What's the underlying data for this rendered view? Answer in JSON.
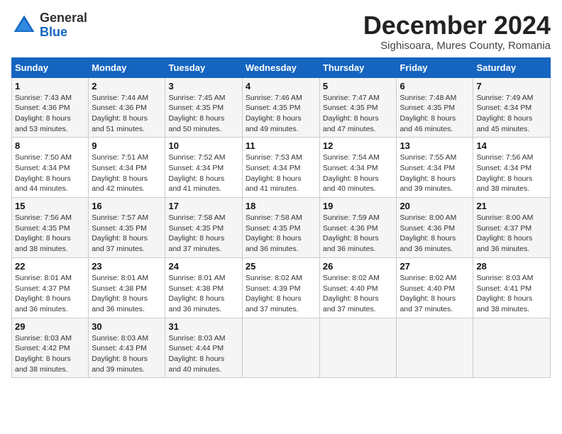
{
  "header": {
    "logo_line1": "General",
    "logo_line2": "Blue",
    "month_year": "December 2024",
    "location": "Sighisoara, Mures County, Romania"
  },
  "weekdays": [
    "Sunday",
    "Monday",
    "Tuesday",
    "Wednesday",
    "Thursday",
    "Friday",
    "Saturday"
  ],
  "weeks": [
    [
      {
        "day": "1",
        "info": "Sunrise: 7:43 AM\nSunset: 4:36 PM\nDaylight: 8 hours\nand 53 minutes."
      },
      {
        "day": "2",
        "info": "Sunrise: 7:44 AM\nSunset: 4:36 PM\nDaylight: 8 hours\nand 51 minutes."
      },
      {
        "day": "3",
        "info": "Sunrise: 7:45 AM\nSunset: 4:35 PM\nDaylight: 8 hours\nand 50 minutes."
      },
      {
        "day": "4",
        "info": "Sunrise: 7:46 AM\nSunset: 4:35 PM\nDaylight: 8 hours\nand 49 minutes."
      },
      {
        "day": "5",
        "info": "Sunrise: 7:47 AM\nSunset: 4:35 PM\nDaylight: 8 hours\nand 47 minutes."
      },
      {
        "day": "6",
        "info": "Sunrise: 7:48 AM\nSunset: 4:35 PM\nDaylight: 8 hours\nand 46 minutes."
      },
      {
        "day": "7",
        "info": "Sunrise: 7:49 AM\nSunset: 4:34 PM\nDaylight: 8 hours\nand 45 minutes."
      }
    ],
    [
      {
        "day": "8",
        "info": "Sunrise: 7:50 AM\nSunset: 4:34 PM\nDaylight: 8 hours\nand 44 minutes."
      },
      {
        "day": "9",
        "info": "Sunrise: 7:51 AM\nSunset: 4:34 PM\nDaylight: 8 hours\nand 42 minutes."
      },
      {
        "day": "10",
        "info": "Sunrise: 7:52 AM\nSunset: 4:34 PM\nDaylight: 8 hours\nand 41 minutes."
      },
      {
        "day": "11",
        "info": "Sunrise: 7:53 AM\nSunset: 4:34 PM\nDaylight: 8 hours\nand 41 minutes."
      },
      {
        "day": "12",
        "info": "Sunrise: 7:54 AM\nSunset: 4:34 PM\nDaylight: 8 hours\nand 40 minutes."
      },
      {
        "day": "13",
        "info": "Sunrise: 7:55 AM\nSunset: 4:34 PM\nDaylight: 8 hours\nand 39 minutes."
      },
      {
        "day": "14",
        "info": "Sunrise: 7:56 AM\nSunset: 4:34 PM\nDaylight: 8 hours\nand 38 minutes."
      }
    ],
    [
      {
        "day": "15",
        "info": "Sunrise: 7:56 AM\nSunset: 4:35 PM\nDaylight: 8 hours\nand 38 minutes."
      },
      {
        "day": "16",
        "info": "Sunrise: 7:57 AM\nSunset: 4:35 PM\nDaylight: 8 hours\nand 37 minutes."
      },
      {
        "day": "17",
        "info": "Sunrise: 7:58 AM\nSunset: 4:35 PM\nDaylight: 8 hours\nand 37 minutes."
      },
      {
        "day": "18",
        "info": "Sunrise: 7:58 AM\nSunset: 4:35 PM\nDaylight: 8 hours\nand 36 minutes."
      },
      {
        "day": "19",
        "info": "Sunrise: 7:59 AM\nSunset: 4:36 PM\nDaylight: 8 hours\nand 36 minutes."
      },
      {
        "day": "20",
        "info": "Sunrise: 8:00 AM\nSunset: 4:36 PM\nDaylight: 8 hours\nand 36 minutes."
      },
      {
        "day": "21",
        "info": "Sunrise: 8:00 AM\nSunset: 4:37 PM\nDaylight: 8 hours\nand 36 minutes."
      }
    ],
    [
      {
        "day": "22",
        "info": "Sunrise: 8:01 AM\nSunset: 4:37 PM\nDaylight: 8 hours\nand 36 minutes."
      },
      {
        "day": "23",
        "info": "Sunrise: 8:01 AM\nSunset: 4:38 PM\nDaylight: 8 hours\nand 36 minutes."
      },
      {
        "day": "24",
        "info": "Sunrise: 8:01 AM\nSunset: 4:38 PM\nDaylight: 8 hours\nand 36 minutes."
      },
      {
        "day": "25",
        "info": "Sunrise: 8:02 AM\nSunset: 4:39 PM\nDaylight: 8 hours\nand 37 minutes."
      },
      {
        "day": "26",
        "info": "Sunrise: 8:02 AM\nSunset: 4:40 PM\nDaylight: 8 hours\nand 37 minutes."
      },
      {
        "day": "27",
        "info": "Sunrise: 8:02 AM\nSunset: 4:40 PM\nDaylight: 8 hours\nand 37 minutes."
      },
      {
        "day": "28",
        "info": "Sunrise: 8:03 AM\nSunset: 4:41 PM\nDaylight: 8 hours\nand 38 minutes."
      }
    ],
    [
      {
        "day": "29",
        "info": "Sunrise: 8:03 AM\nSunset: 4:42 PM\nDaylight: 8 hours\nand 38 minutes."
      },
      {
        "day": "30",
        "info": "Sunrise: 8:03 AM\nSunset: 4:43 PM\nDaylight: 8 hours\nand 39 minutes."
      },
      {
        "day": "31",
        "info": "Sunrise: 8:03 AM\nSunset: 4:44 PM\nDaylight: 8 hours\nand 40 minutes."
      },
      null,
      null,
      null,
      null
    ]
  ]
}
